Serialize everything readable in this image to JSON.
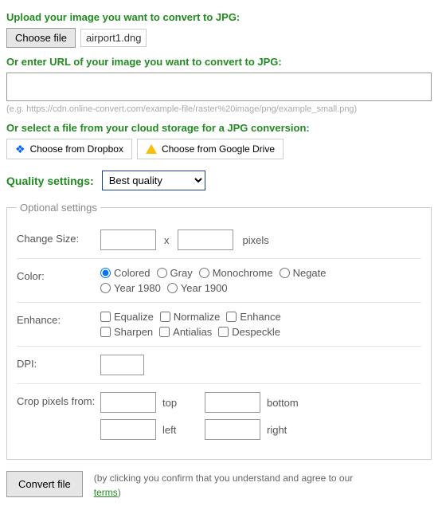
{
  "upload": {
    "title": "Upload your image you want to convert to JPG:",
    "choose_label": "Choose file",
    "filename": "airport1.dng"
  },
  "url": {
    "title": "Or enter URL of your image you want to convert to JPG:",
    "value": "",
    "hint": "(e.g. https://cdn.online-convert.com/example-file/raster%20image/png/example_small.png)"
  },
  "cloud": {
    "title": "Or select a file from your cloud storage for a JPG conversion:",
    "dropbox_label": "Choose from Dropbox",
    "gdrive_label": "Choose from Google Drive"
  },
  "quality": {
    "label": "Quality settings:",
    "selected": "Best quality"
  },
  "optional": {
    "legend": "Optional settings",
    "change_size": {
      "label": "Change Size:",
      "w": "",
      "h": "",
      "x": "x",
      "unit": "pixels"
    },
    "color": {
      "label": "Color:",
      "options": [
        "Colored",
        "Gray",
        "Monochrome",
        "Negate",
        "Year 1980",
        "Year 1900"
      ],
      "selected": "Colored"
    },
    "enhance": {
      "label": "Enhance:",
      "options": [
        "Equalize",
        "Normalize",
        "Enhance",
        "Sharpen",
        "Antialias",
        "Despeckle"
      ]
    },
    "dpi": {
      "label": "DPI:",
      "value": ""
    },
    "crop": {
      "label": "Crop pixels from:",
      "top_label": "top",
      "bottom_label": "bottom",
      "left_label": "left",
      "right_label": "right",
      "top": "",
      "bottom": "",
      "left": "",
      "right": ""
    }
  },
  "submit": {
    "button": "Convert file",
    "disclaimer_pre": "(by clicking you confirm that you understand and agree to our ",
    "terms": "terms",
    "disclaimer_post": ")"
  }
}
